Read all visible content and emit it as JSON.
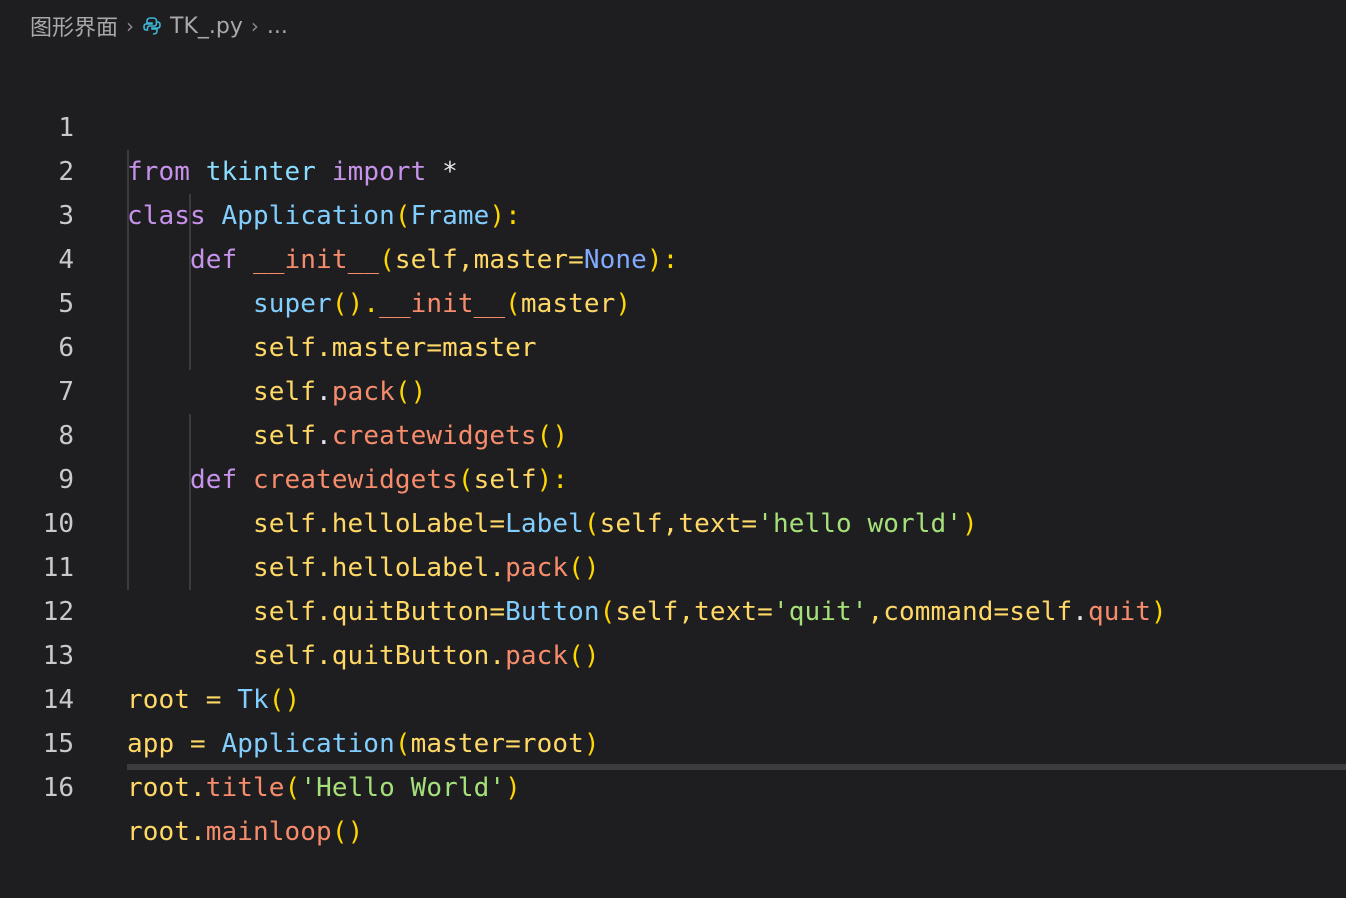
{
  "breadcrumb": {
    "folder": "图形界面",
    "file": "TK_.py",
    "more": "..."
  },
  "colors": {
    "background": "#1e1e20",
    "keyword": "#c792ea",
    "class": "#82cfff",
    "self": "#ffd866",
    "method": "#f78c6c",
    "string": "#a5e07a"
  },
  "lines": [
    {
      "num": "1"
    },
    {
      "num": "2"
    },
    {
      "num": "3"
    },
    {
      "num": "4"
    },
    {
      "num": "5"
    },
    {
      "num": "6"
    },
    {
      "num": "7"
    },
    {
      "num": "8"
    },
    {
      "num": "9"
    },
    {
      "num": "10"
    },
    {
      "num": "11"
    },
    {
      "num": "12"
    },
    {
      "num": "13"
    },
    {
      "num": "14"
    },
    {
      "num": "15"
    },
    {
      "num": "16"
    }
  ],
  "tokens": {
    "l1": [
      "from",
      " ",
      "tkinter",
      " ",
      "import",
      " *"
    ],
    "l2": [
      "class",
      " ",
      "Application",
      "(",
      "Frame",
      "):"
    ],
    "l3": [
      "    ",
      "def",
      " ",
      "__init__",
      "(",
      "self",
      ",master=",
      "None",
      "):"
    ],
    "l4": [
      "        ",
      "super",
      "().",
      "__init__",
      "(",
      "master",
      ")"
    ],
    "l5": [
      "        ",
      "self",
      ".master=master"
    ],
    "l6": [
      "        ",
      "self",
      ".",
      "pack",
      "()"
    ],
    "l7": [
      "        ",
      "self",
      ".",
      "createwidgets",
      "()"
    ],
    "l8": [
      "    ",
      "def",
      " ",
      "createwidgets",
      "(",
      "self",
      "):"
    ],
    "l9": [
      "        ",
      "self",
      ".helloLabel=",
      "Label",
      "(",
      "self",
      ",text=",
      "'hello world'",
      ")"
    ],
    "l10": [
      "        ",
      "self",
      ".helloLabel.",
      "pack",
      "()"
    ],
    "l11": [
      "        ",
      "self",
      ".quitButton=",
      "Button",
      "(",
      "self",
      ",text=",
      "'quit'",
      ",command=",
      "self",
      ".",
      "quit",
      ")"
    ],
    "l12": [
      "        ",
      "self",
      ".quitButton.",
      "pack",
      "()"
    ],
    "l13": [
      "root = ",
      "Tk",
      "()"
    ],
    "l14": [
      "app = ",
      "Application",
      "(",
      "master=root",
      ")"
    ],
    "l15": [
      "root.",
      "title",
      "(",
      "'Hello World'",
      ")"
    ],
    "l16": [
      "root.",
      "mainloop",
      "()"
    ]
  }
}
